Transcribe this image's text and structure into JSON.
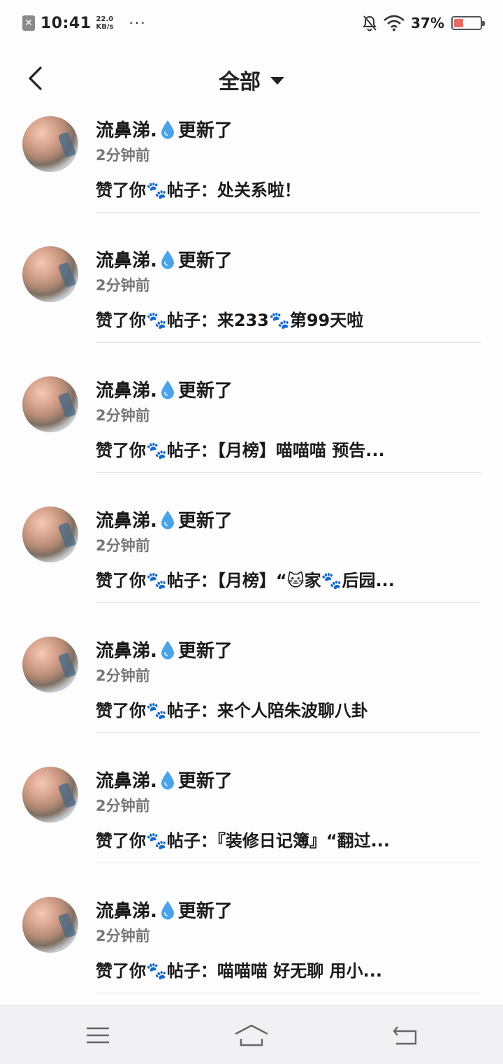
{
  "status_bar": {
    "sim_icon": "sim-card-x-icon",
    "time": "10:41",
    "net_speed_value": "22.0",
    "net_speed_unit": "KB/s",
    "more": "···",
    "battery_percent": "37%",
    "battery_level": 0.37,
    "battery_color": "#e56b6b"
  },
  "header": {
    "title": "全部"
  },
  "notifications": [
    {
      "name": "流鼻涕.",
      "suffix": "更新了",
      "time": "2分钟前",
      "action": "赞了你🐾帖子：处关系啦！"
    },
    {
      "name": "流鼻涕.",
      "suffix": "更新了",
      "time": "2分钟前",
      "action": "赞了你🐾帖子：来233🐾第99天啦"
    },
    {
      "name": "流鼻涕.",
      "suffix": "更新了",
      "time": "2分钟前",
      "action": "赞了你🐾帖子：【月榜】喵喵喵 预告..."
    },
    {
      "name": "流鼻涕.",
      "suffix": "更新了",
      "time": "2分钟前",
      "action": "赞了你🐾帖子：【月榜】“🐱家🐾后园..."
    },
    {
      "name": "流鼻涕.",
      "suffix": "更新了",
      "time": "2分钟前",
      "action": "赞了你🐾帖子：来个人陪朱波聊八卦"
    },
    {
      "name": "流鼻涕.",
      "suffix": "更新了",
      "time": "2分钟前",
      "action": "赞了你🐾帖子：『装修日记簿』“翻过..."
    },
    {
      "name": "流鼻涕.",
      "suffix": "更新了",
      "time": "2分钟前",
      "action": "赞了你🐾帖子：喵喵喵 好无聊 用小..."
    }
  ],
  "nav": {
    "menu_icon": "menu-icon",
    "home_icon": "home-icon",
    "back_icon": "back-icon"
  }
}
